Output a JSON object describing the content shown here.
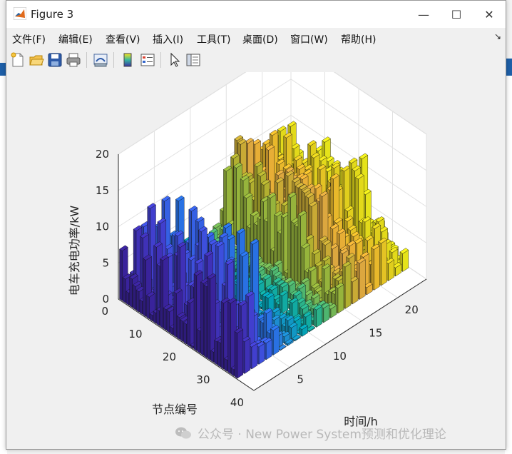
{
  "window": {
    "title": "Figure 3",
    "controls": {
      "minimize": "—",
      "maximize": "☐",
      "close": "✕"
    }
  },
  "menu": [
    {
      "label": "文件(F)"
    },
    {
      "label": "编辑(E)"
    },
    {
      "label": "查看(V)"
    },
    {
      "label": "插入(I)"
    },
    {
      "label": "工具(T)"
    },
    {
      "label": "桌面(D)"
    },
    {
      "label": "窗口(W)"
    },
    {
      "label": "帮助(H)"
    }
  ],
  "dock_arrow": "↘",
  "toolbar": [
    {
      "name": "new-figure-icon"
    },
    {
      "name": "open-file-icon"
    },
    {
      "name": "save-icon"
    },
    {
      "name": "print-icon"
    },
    {
      "name": "link-plot-icon"
    },
    {
      "name": "colorbar-icon"
    },
    {
      "name": "legend-icon"
    },
    {
      "name": "pointer-icon"
    },
    {
      "name": "property-editor-icon"
    }
  ],
  "chart_data": {
    "type": "bar3",
    "zlabel": "电车充电功率/kW",
    "xlabel": "时间/h",
    "ylabel": "节点编号",
    "z_ticks": [
      0,
      5,
      10,
      15,
      20
    ],
    "node_ticks": [
      0,
      10,
      20,
      30,
      40
    ],
    "time_ticks": [
      5,
      10,
      15,
      20
    ],
    "zlim": [
      0,
      20
    ],
    "node_range": [
      0,
      40
    ],
    "time_range": [
      0,
      24
    ],
    "colormap": "parula",
    "grid": true,
    "peak_value": 14,
    "description_values": {
      "node_region_high": "nodes 1-35, hours 1-6: up to ~14 kW",
      "mid_region_low": "hours 7-14: mostly 0-3 kW",
      "late_region": "hours 15-24: up to ~12 kW"
    }
  },
  "watermark": "公众号 · New Power System预测和优化理论"
}
